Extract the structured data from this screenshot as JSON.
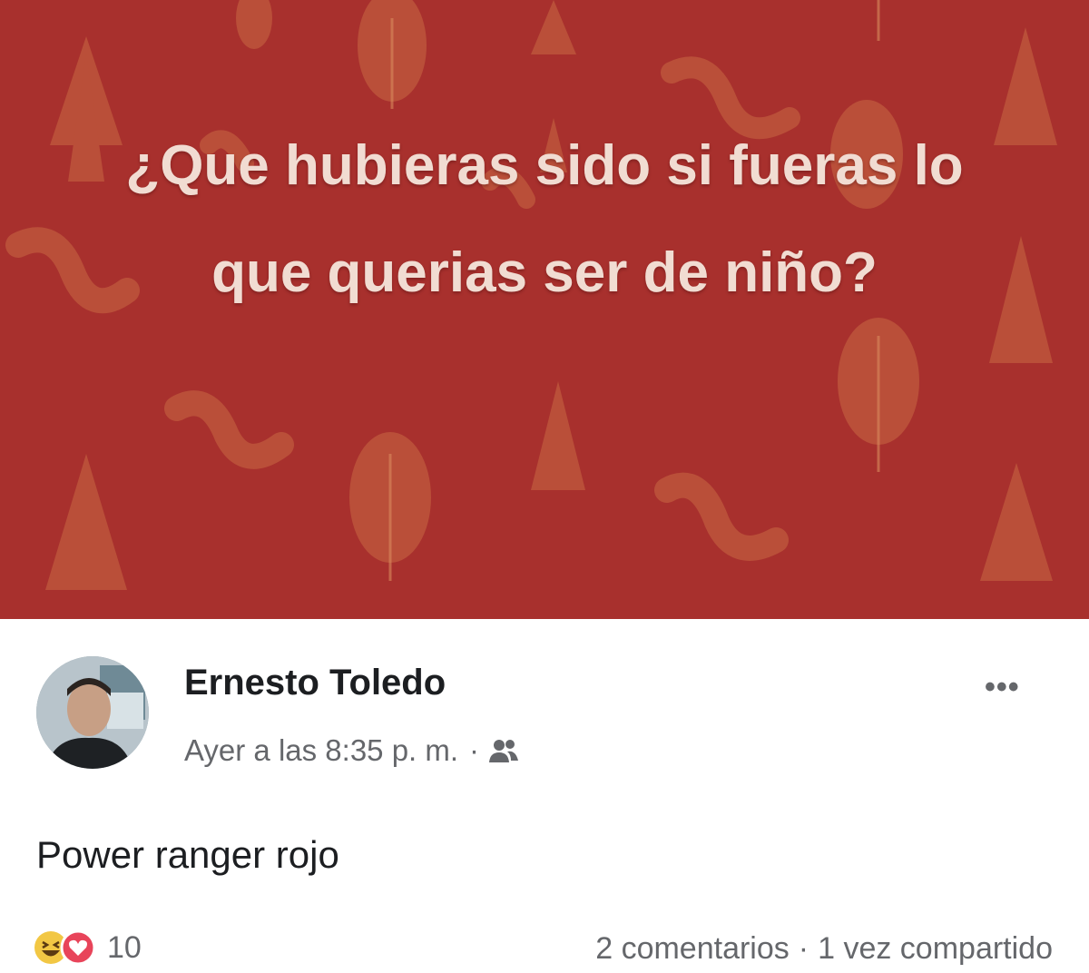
{
  "banner": {
    "question": "¿Que hubieras sido si fueras lo que querias ser de niño?",
    "background_color": "#a8302d",
    "pattern_color": "#c96a43"
  },
  "post": {
    "author": "Ernesto Toledo",
    "time": "Ayer a las 8:35 p. m.",
    "separator": "·",
    "audience_icon": "friends-icon",
    "more_label": "•••",
    "text": "Power ranger rojo"
  },
  "footer": {
    "reaction_icons": [
      "haha-icon",
      "love-icon"
    ],
    "reaction_count": "10",
    "comments": "2 comentarios",
    "separator": "·",
    "shares": "1 vez compartido"
  }
}
